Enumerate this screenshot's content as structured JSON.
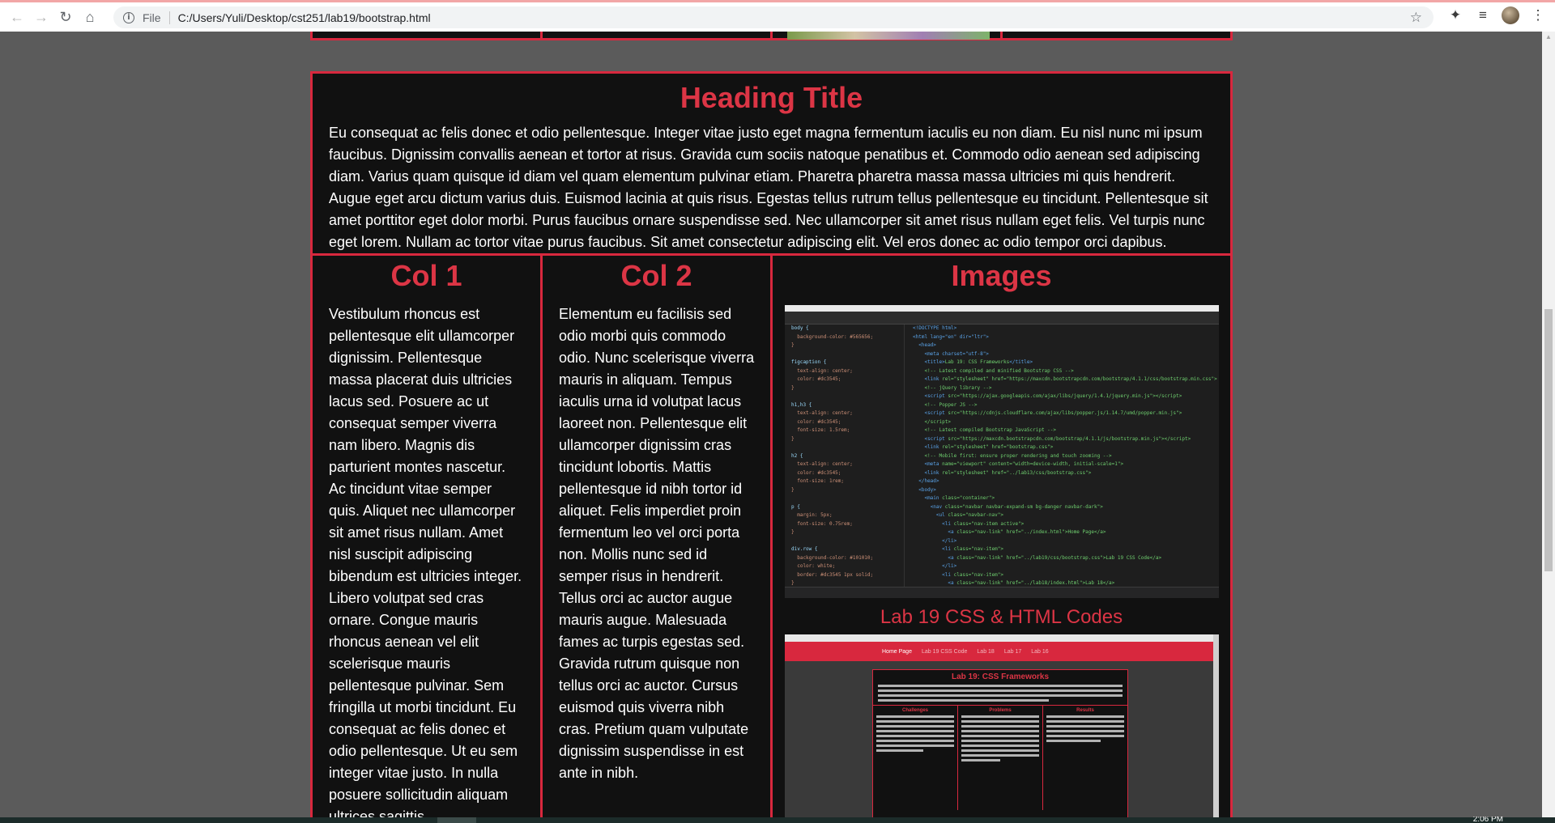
{
  "browser": {
    "file_label": "File",
    "url": "C:/Users/Yuli/Desktop/cst251/lab19/bootstrap.html"
  },
  "main": {
    "heading": "Heading Title",
    "intro": "Eu consequat ac felis donec et odio pellentesque. Integer vitae justo eget magna fermentum iaculis eu non diam. Eu nisl nunc mi ipsum faucibus. Dignissim convallis aenean et tortor at risus. Gravida cum sociis natoque penatibus et. Commodo odio aenean sed adipiscing diam. Varius quam quisque id diam vel quam elementum pulvinar etiam. Pharetra pharetra massa massa ultricies mi quis hendrerit. Augue eget arcu dictum varius duis. Euismod lacinia at quis risus. Egestas tellus rutrum tellus pellentesque eu tincidunt. Pellentesque sit amet porttitor eget dolor morbi. Purus faucibus ornare suspendisse sed. Nec ullamcorper sit amet risus nullam eget felis. Vel turpis nunc eget lorem. Nullam ac tortor vitae purus faucibus. Sit amet consectetur adipiscing elit. Vel eros donec ac odio tempor orci dapibus.",
    "col1": {
      "title": "Col 1",
      "text": "Vestibulum rhoncus est pellentesque elit ullamcorper dignissim. Pellentesque massa placerat duis ultricies lacus sed. Posuere ac ut consequat semper viverra nam libero. Magnis dis parturient montes nascetur. Ac tincidunt vitae semper quis. Aliquet nec ullamcorper sit amet risus nullam. Amet nisl suscipit adipiscing bibendum est ultricies integer. Libero volutpat sed cras ornare. Congue mauris rhoncus aenean vel elit scelerisque mauris pellentesque pulvinar. Sem fringilla ut morbi tincidunt. Eu consequat ac felis donec et odio pellentesque. Ut eu sem integer vitae justo. In nulla posuere sollicitudin aliquam ultrices sagittis."
    },
    "col2": {
      "title": "Col 2",
      "text": "Elementum eu facilisis sed odio morbi quis commodo odio. Nunc scelerisque viverra mauris in aliquam. Tempus iaculis urna id volutpat lacus laoreet non. Pellentesque elit ullamcorper dignissim cras tincidunt lobortis. Mattis pellentesque id nibh tortor id aliquet. Felis imperdiet proin fermentum leo vel orci porta non. Mollis nunc sed id semper risus in hendrerit. Tellus orci ac auctor augue mauris augue. Malesuada fames ac turpis egestas sed. Gravida rutrum quisque non tellus orci ac auctor. Cursus euismod quis viverra nibh cras. Pretium quam vulputate dignissim suspendisse in est ante in nibh."
    },
    "col3": {
      "title": "Images",
      "caption": "Lab 19 CSS & HTML Codes"
    }
  },
  "screenshot2": {
    "nav_items": [
      "Home Page",
      "Lab 19 CSS Code",
      "Lab 18",
      "Lab 17",
      "Lab 16"
    ],
    "title": "Lab 19: CSS Frameworks",
    "col_titles": [
      "Challenges",
      "Problems",
      "Results"
    ]
  },
  "taskbar": {
    "clock": "2:06 PM"
  }
}
